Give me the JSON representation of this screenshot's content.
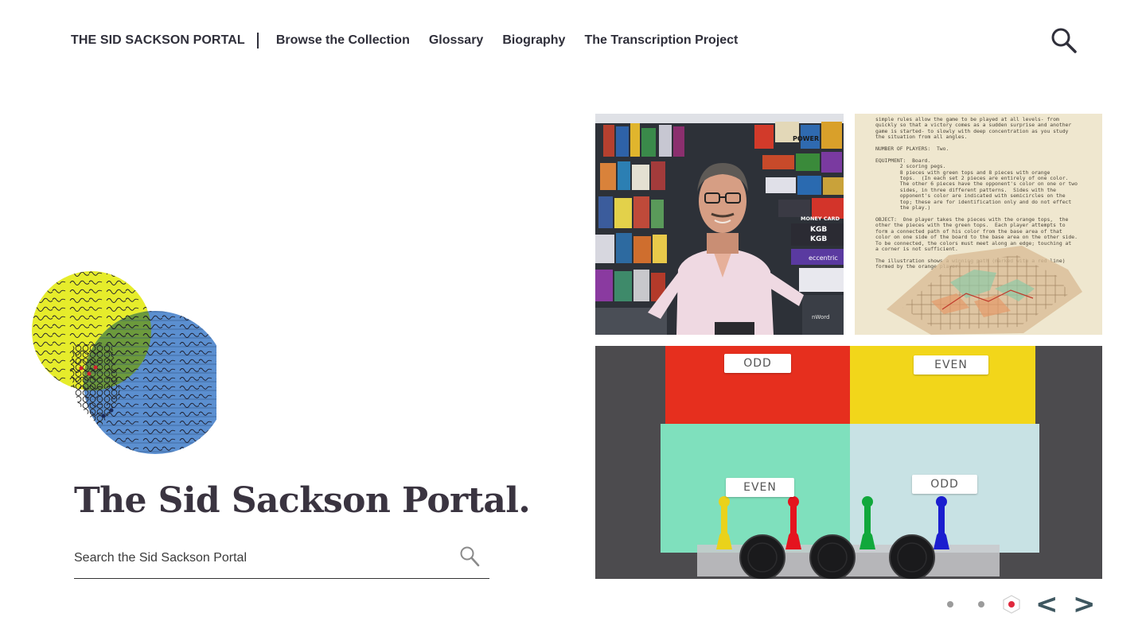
{
  "header": {
    "brand": "THE SID SACKSON PORTAL",
    "nav": [
      {
        "label": "Browse the Collection"
      },
      {
        "label": "Glossary"
      },
      {
        "label": "Biography"
      },
      {
        "label": "The Transcription Project"
      }
    ],
    "search_icon": "search-icon"
  },
  "hero": {
    "title": "The Sid Sackson Portal.",
    "search": {
      "placeholder": "Search the Sid Sackson Portal",
      "value": ""
    }
  },
  "gallery": {
    "odd_even_labels": [
      "ODD",
      "EVEN",
      "EVEN",
      "ODD"
    ],
    "doc_text": "simple rules allow the game to be played at all levels- from\nquickly so that a victory comes as a sudden surprise and another\ngame is started- to slowly with deep concentration as you study\nthe situation from all angles.\n\nNUMBER OF PLAYERS:  Two.\n\nEQUIPMENT:  Board.\n        2 scoring pegs.\n        8 pieces with green tops and 8 pieces with orange\n        tops.  (In each set 2 pieces are entirely of one color.\n        The other 6 pieces have the opponent's color on one or two\n        sides, in three different patterns.  Sides with the\n        opponent's color are indicated with semicircles on the\n        top; these are for identification only and do not effect\n        the play.)\n\nOBJECT:  One player takes the pieces with the orange tops,  the\nother the pieces with the green tops.  Each player attempts to\nform a connected path of his color from the base area of that\ncolor on one side of the board to the base area on the other side.\nTo be connected, the colors must meet along an edge; touching at\na corner is not sufficient.\n\nThe illustration shows a winning path (marked with a red line)\nformed by the orange player.",
    "box_labels": [
      "POWER",
      "MONEY CARD",
      "KGB",
      "KGB",
      "eccentric",
      "nWord"
    ]
  },
  "carousel": {
    "slide_count": 3,
    "active_slide": 3,
    "prev_label": "<",
    "next_label": ">"
  },
  "colors": {
    "text": "#2f2f3a",
    "title": "#3a3440",
    "arrow": "#3e5760",
    "dot": "#9b9b9b",
    "active_dot": "#e0283c",
    "logo_yellow": "#e6ec2b",
    "logo_blue": "#5b8fd0",
    "logo_overlap": "#6c9a3c"
  }
}
